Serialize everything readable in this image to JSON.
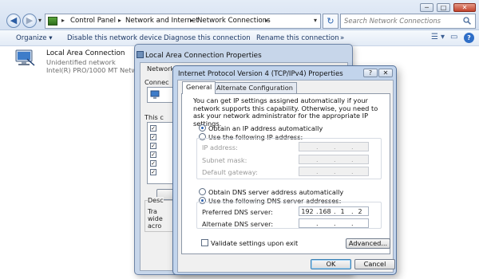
{
  "explorer": {
    "breadcrumb": [
      "Control Panel",
      "Network and Internet",
      "Network Connections"
    ],
    "search_placeholder": "Search Network Connections",
    "toolbar": [
      "Organize ▾",
      "Disable this network device",
      "Diagnose this connection",
      "Rename this connection",
      "»"
    ],
    "connection": {
      "name": "Local Area Connection",
      "status": "Unidentified network",
      "adapter": "Intel(R) PRO/1000 MT Netwo"
    }
  },
  "lacp_dialog": {
    "title": "Local Area Connection Properties",
    "tab": "Network",
    "connect_label": "Connec",
    "this_label": "This c",
    "desc_label": "Desc",
    "desc_lines": [
      "Tra",
      "wide",
      "acro"
    ]
  },
  "ipv4_dialog": {
    "title": "Internet Protocol Version 4 (TCP/IPv4) Properties",
    "help_btn": "?",
    "close_btn": "✕",
    "tabs": [
      "General",
      "Alternate Configuration"
    ],
    "description": "You can get IP settings assigned automatically if your network supports this capability. Otherwise, you need to ask your network administrator for the appropriate IP settings.",
    "ip_auto": "Obtain an IP address automatically",
    "ip_manual": "Use the following IP address:",
    "ip_fields": [
      "IP address:",
      "Subnet mask:",
      "Default gateway:"
    ],
    "dns_auto": "Obtain DNS server address automatically",
    "dns_manual": "Use the following DNS server addresses:",
    "preferred_dns_label": "Preferred DNS server:",
    "preferred_dns": [
      "192",
      "168",
      "1",
      "2"
    ],
    "alternate_dns_label": "Alternate DNS server:",
    "validate_label": "Validate settings upon exit",
    "advanced_btn": "Advanced...",
    "ok_btn": "OK",
    "cancel_btn": "Cancel"
  }
}
